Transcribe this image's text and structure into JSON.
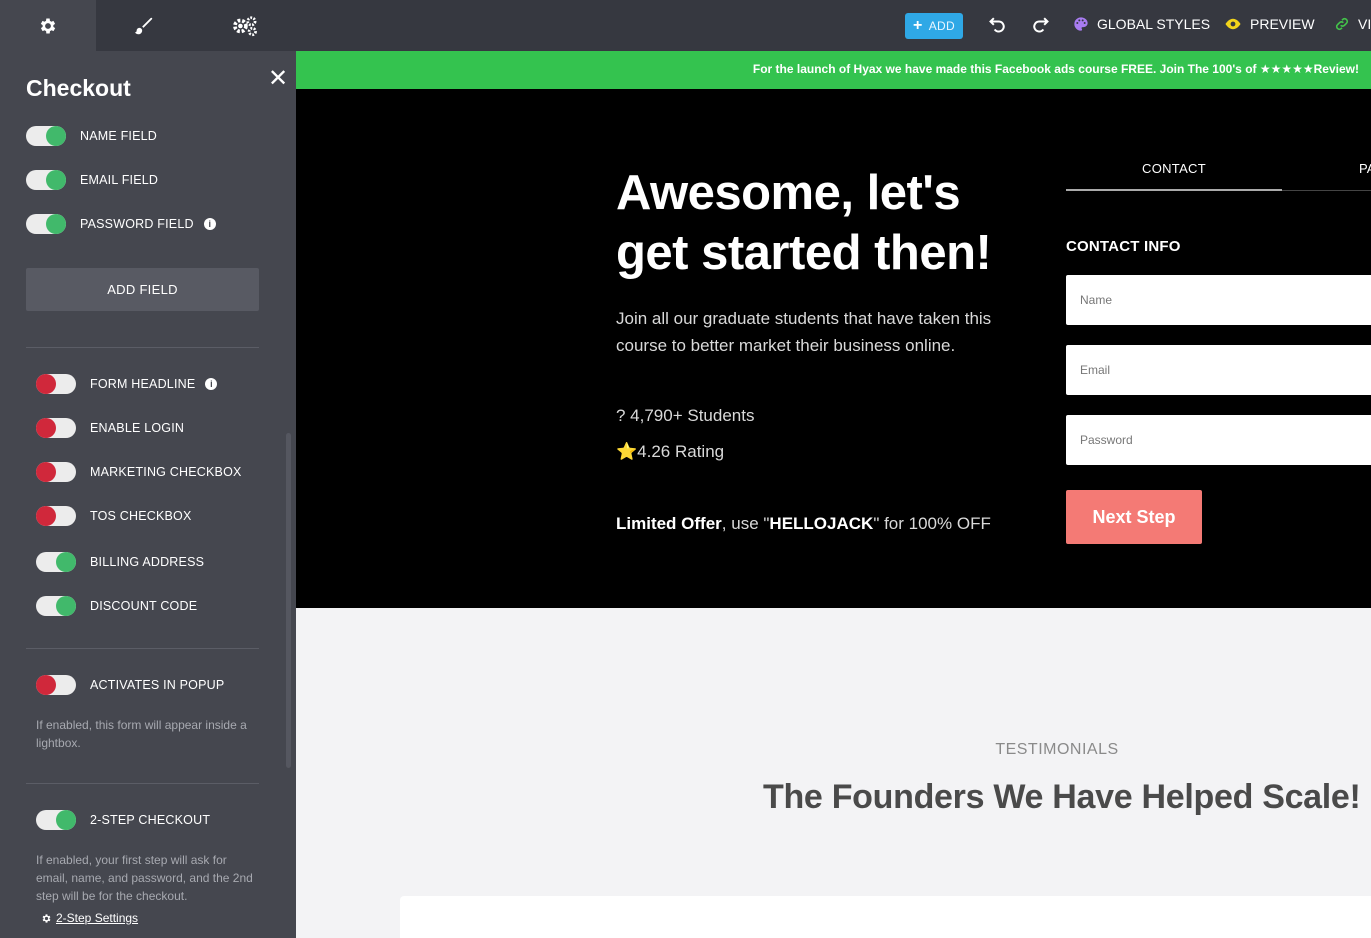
{
  "topbar": {
    "tabs": [
      "settings-gear",
      "paint-brush",
      "advanced-settings"
    ],
    "add_label": "ADD",
    "add_plus": "+",
    "global_styles_label": "GLOBAL STYLES",
    "preview_label": "PREVIEW",
    "view_label": "VI",
    "accent_add": "#2fa8e6"
  },
  "sidebar": {
    "title": "Checkout",
    "close": "✕",
    "fields": [
      {
        "label": "NAME FIELD",
        "on": true
      },
      {
        "label": "EMAIL FIELD",
        "on": true
      },
      {
        "label": "PASSWORD FIELD",
        "on": true
      }
    ],
    "add_field_label": "ADD FIELD",
    "options": [
      {
        "label": "FORM HEADLINE",
        "on": false
      },
      {
        "label": "ENABLE LOGIN",
        "on": false
      },
      {
        "label": "MARKETING CHECKBOX",
        "on": false
      },
      {
        "label": "TOS CHECKBOX",
        "on": false
      },
      {
        "label": "BILLING ADDRESS",
        "on": true
      },
      {
        "label": "DISCOUNT CODE",
        "on": true
      }
    ],
    "popup": {
      "label": "ACTIVATES IN POPUP",
      "on": false,
      "help": "If enabled, this form will appear inside a lightbox."
    },
    "two_step": {
      "label": "2-STEP CHECKOUT",
      "on": true,
      "help": "If enabled, your first step will ask for email, name, and password, and the 2nd step will be for the checkout.",
      "link": "2-Step Settings"
    },
    "info_glyph": "i",
    "toggle_on_color": "#41b96b",
    "toggle_off_color": "#d0283b"
  },
  "page": {
    "banner": "For the launch of Hyax we have made this Facebook ads course FREE. Join The 100's of ★★★★★Review!",
    "headline": "Awesome, let's get started then!",
    "subtext": "Join all our graduate students that have taken this course to better market their business online.",
    "students": "? 4,790+ Students",
    "rating": "⭐4.26 Rating",
    "offer_prefix": "Limited Offer",
    "offer_mid": ", use \"",
    "offer_code": "HELLOJACK",
    "offer_suffix": "\" for 100% OFF",
    "tabs": {
      "contact": "CONTACT",
      "payment": "PA"
    },
    "contact_info": "CONTACT INFO",
    "fields": {
      "name": "Name",
      "email": "Email",
      "password": "Password"
    },
    "next_step": "Next Step",
    "testimonials_label": "TESTIMONIALS",
    "testimonials_title": "The Founders We Have Helped Scale!",
    "banner_color": "#34c34f",
    "button_color": "#f47a75"
  }
}
